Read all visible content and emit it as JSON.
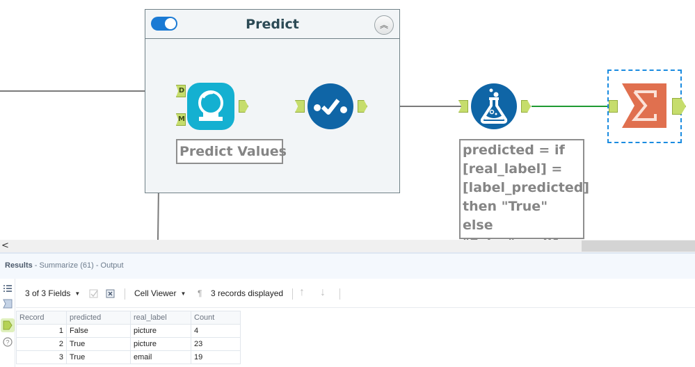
{
  "canvas": {
    "container": {
      "title": "Predict",
      "toggle_enabled": true,
      "collapse_icon": "chevron-double-up-icon"
    },
    "tools": [
      {
        "id": "predict",
        "icon": "crystal-ball-icon",
        "annotation": "Predict Values",
        "color": "#14b0d1",
        "inputs": [
          "D",
          "M"
        ]
      },
      {
        "id": "score",
        "icon": "score-check-icon",
        "color": "#0f65a6"
      },
      {
        "id": "formula",
        "icon": "flask-icon",
        "color": "#0f65a6",
        "annotation": "predicted = if\n[real_label] =\n[label_predicted]\nthen \"True\" else\n\"False\" endif"
      },
      {
        "id": "summarize",
        "icon": "sigma-icon",
        "color": "#e0704f",
        "selected": true
      }
    ],
    "colors": {
      "port": "#c6dd6c",
      "wire": "#7a7a7a",
      "wire_active": "#1e9a32",
      "selection": "#1a8be0"
    }
  },
  "scrollbar": {
    "left_arrow": "<"
  },
  "results": {
    "title": "Results",
    "subtitle": " - Summarize (61) - Output",
    "toolbar": {
      "fields": "3 of 3 Fields",
      "viewer": "Cell Viewer",
      "records": "3 records displayed"
    },
    "table": {
      "columns": [
        "Record",
        "predicted",
        "real_label",
        "Count"
      ],
      "rows": [
        {
          "record": "1",
          "predicted": "False",
          "real_label": "picture",
          "count": "4"
        },
        {
          "record": "2",
          "predicted": "True",
          "real_label": "picture",
          "count": "23"
        },
        {
          "record": "3",
          "predicted": "True",
          "real_label": "email",
          "count": "19"
        }
      ]
    }
  }
}
